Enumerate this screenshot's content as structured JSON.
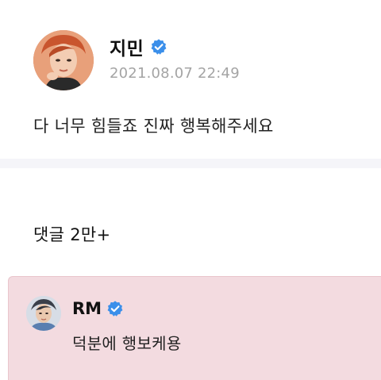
{
  "post": {
    "author": "지민",
    "timestamp": "2021.08.07 22:49",
    "body": "다 너무 힘들죠 진짜 행복해주세요",
    "avatar_icon": "jimin-avatar",
    "verified_icon": "verified-badge-icon"
  },
  "comments": {
    "heading": "댓글 2만+",
    "items": [
      {
        "author": "RM",
        "text": "덕분에 행보케용",
        "avatar_icon": "rm-avatar",
        "verified_icon": "verified-badge-icon"
      }
    ]
  },
  "colors": {
    "verified_blue": "#3b8fea",
    "timestamp_gray": "#a4a4a4",
    "highlight_pink": "#f3dbe0",
    "divider_gray": "#f5f5f9"
  }
}
